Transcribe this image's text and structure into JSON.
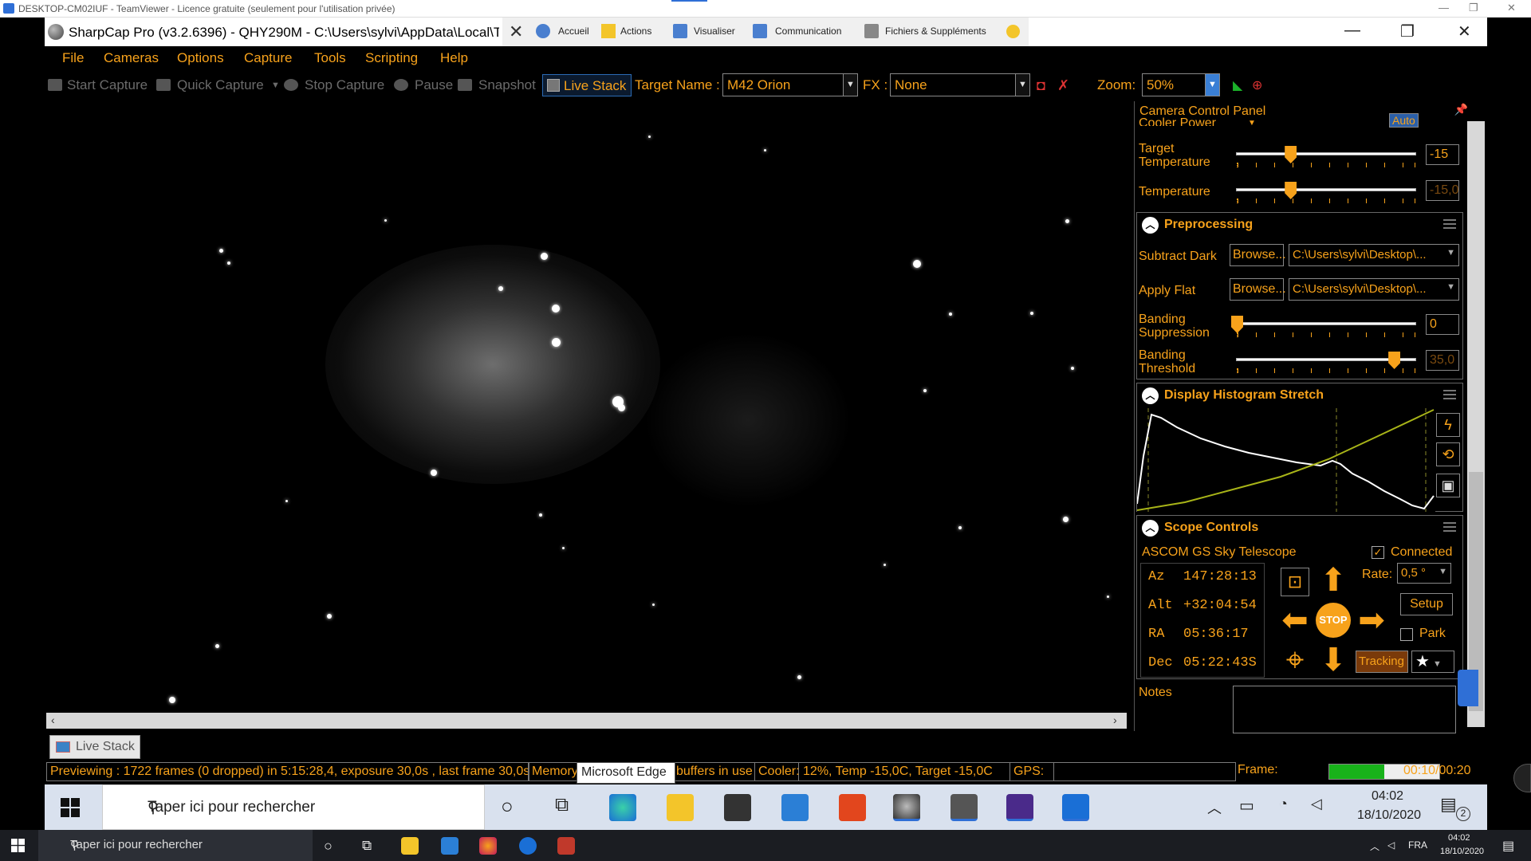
{
  "teamviewer": {
    "title": "DESKTOP-CM02IUF - TeamViewer - Licence gratuite (seulement pour l'utilisation privée)",
    "toolbar": [
      "Accueil",
      "Actions",
      "Visualiser",
      "Communication",
      "Fichiers & Suppléments"
    ]
  },
  "app": {
    "title": "SharpCap Pro (v3.2.6396) - QHY290M - C:\\Users\\sylvi\\AppData\\Local\\Ter"
  },
  "menu": [
    "File",
    "Cameras",
    "Options",
    "Capture",
    "Tools",
    "Scripting",
    "Help"
  ],
  "toolbar": {
    "start_capture": "Start Capture",
    "quick_capture": "Quick Capture",
    "stop_capture": "Stop Capture",
    "pause": "Pause",
    "snapshot": "Snapshot",
    "live_stack": "Live Stack",
    "target_label": "Target Name :",
    "target_value": "M42 Orion",
    "fx_label": "FX :",
    "fx_value": "None",
    "zoom_label": "Zoom:",
    "zoom_value": "50%"
  },
  "panel": {
    "title": "Camera Control Panel",
    "top_partial_label": "Cooler Power",
    "top_partial_btn": "Auto",
    "target_temp": {
      "label1": "Target",
      "label2": "Temperature",
      "value": "-15",
      "level": 0.3
    },
    "temperature": {
      "label": "Temperature",
      "value": "-15,0",
      "level": 0.3
    },
    "preprocessing": {
      "title": "Preprocessing",
      "subtract_dark": "Subtract Dark",
      "apply_flat": "Apply Flat",
      "browse": "Browse...",
      "dark_path": "C:\\Users\\sylvi\\Desktop\\...",
      "flat_path": "C:\\Users\\sylvi\\Desktop\\...",
      "banding_supp1": "Banding",
      "banding_supp2": "Suppression",
      "banding_supp_value": "0",
      "banding_supp_level": 0.0,
      "banding_thr1": "Banding",
      "banding_thr2": "Threshold",
      "banding_thr_value": "35,0",
      "banding_thr_level": 0.88
    },
    "histogram": {
      "title": "Display Histogram Stretch"
    },
    "scope": {
      "title": "Scope Controls",
      "device": "ASCOM GS Sky Telescope",
      "connected": "Connected",
      "az_label": "Az",
      "az": "147:28:13",
      "alt_label": "Alt",
      "alt": "+32:04:54",
      "ra_label": "RA",
      "ra": "05:36:17",
      "dec_label": "Dec",
      "dec": "05:22:43S",
      "rate_label": "Rate:",
      "rate": "0,5 °",
      "setup": "Setup",
      "park": "Park",
      "tracking": "Tracking",
      "stop": "STOP"
    },
    "notes_label": "Notes"
  },
  "tab_label": "Live Stack",
  "status": {
    "preview": "Previewing : 1722 frames (0 dropped) in 5:15:28,4, exposure 30,0s , last frame 30,0s",
    "memory": "Memory:",
    "buffers": "buffers in use",
    "cooler": "Cooler: 12%, Temp -15,0C, Target -15,0C",
    "gps": "GPS:",
    "frame_label": "Frame:",
    "frame_time": "00:10/00:20",
    "frame_progress": 0.5
  },
  "tooltip": "Microsoft Edge",
  "taskbar1": {
    "search": "Taper ici pour rechercher",
    "time": "04:02",
    "date": "18/10/2020",
    "notif": "2"
  },
  "taskbar2": {
    "search": "Taper ici pour rechercher",
    "lang": "FRA",
    "time": "04:02",
    "date": "18/10/2020"
  },
  "colors": {
    "accent": "#f7a21b",
    "background": "#000000",
    "frame_bar": "#18b21a"
  }
}
